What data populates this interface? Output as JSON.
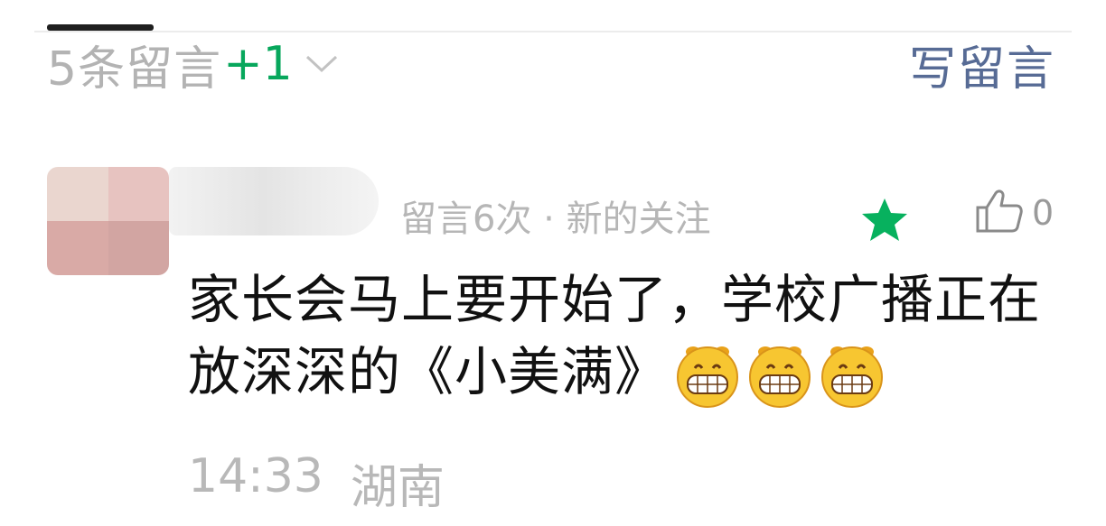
{
  "comments_header": {
    "count_label": "5条留言",
    "count_delta": "+1",
    "write_label": "写留言"
  },
  "comment": {
    "meta": "留言6次 · 新的关注",
    "like_count": "0",
    "text": "家长会马上要开始了，学校广播正在放深深的《小美满》",
    "emoji": [
      "grinning-face",
      "grinning-face",
      "grinning-face"
    ],
    "time": "14:33",
    "location": "湖南"
  },
  "colors": {
    "accent_green": "#07a75c",
    "link_blue": "#576b95"
  }
}
